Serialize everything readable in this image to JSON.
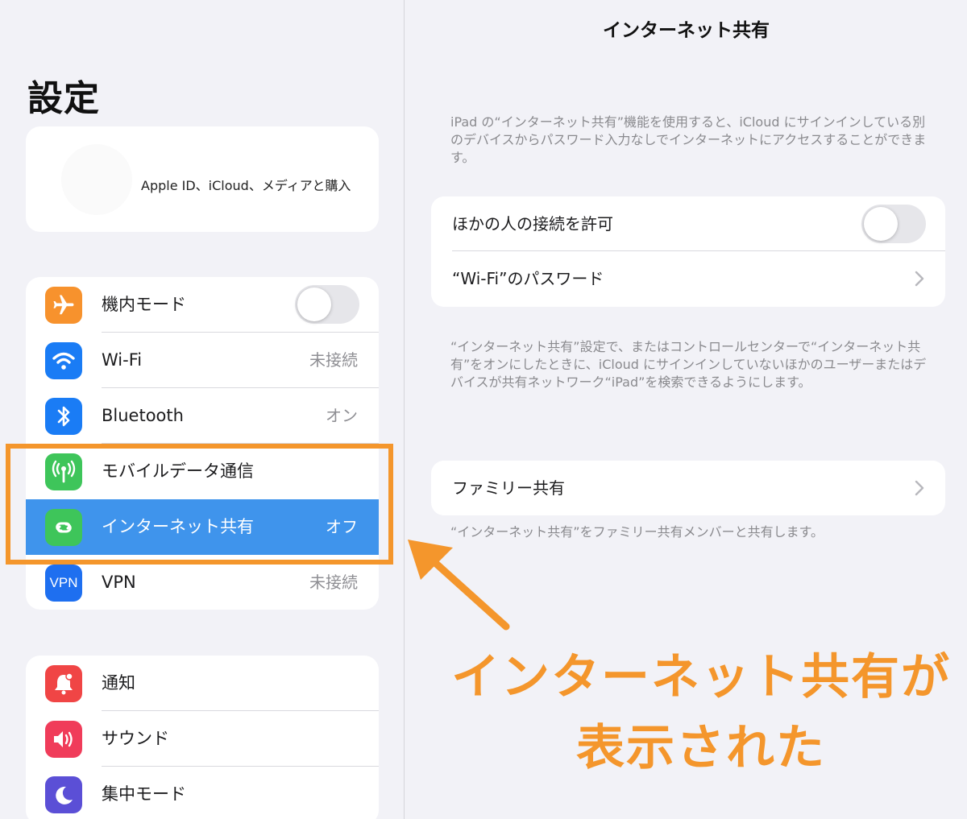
{
  "sidebar": {
    "title": "設定",
    "profile_subtitle": "Apple ID、iCloud、メディアと購入",
    "group1": [
      {
        "name": "airplane",
        "label": "機内モード",
        "value": "",
        "icon": "airplane-icon",
        "color": "#f7922d",
        "toggle": "off"
      },
      {
        "name": "wifi",
        "label": "Wi-Fi",
        "value": "未接続",
        "icon": "wifi-icon",
        "color": "#1a7cf5"
      },
      {
        "name": "bluetooth",
        "label": "Bluetooth",
        "value": "オン",
        "icon": "bluetooth-icon",
        "color": "#1a7cf5"
      },
      {
        "name": "cellular",
        "label": "モバイルデータ通信",
        "value": "",
        "icon": "antenna-icon",
        "color": "#3ec55a"
      },
      {
        "name": "hotspot",
        "label": "インターネット共有",
        "value": "オフ",
        "icon": "hotspot-link-icon",
        "color": "#3ec55a",
        "selected": true
      },
      {
        "name": "vpn",
        "label": "VPN",
        "value": "未接続",
        "icon": "vpn-icon",
        "icon_text": "VPN",
        "color": "#1e6ff0"
      }
    ],
    "group2": [
      {
        "name": "notifications",
        "label": "通知",
        "icon": "bell-icon",
        "color": "#f04545"
      },
      {
        "name": "sounds",
        "label": "サウンド",
        "icon": "speaker-icon",
        "color": "#f03c5a"
      },
      {
        "name": "focus",
        "label": "集中モード",
        "icon": "moon-icon",
        "color": "#5b4fd6"
      }
    ]
  },
  "detail": {
    "nav_title": "インターネット共有",
    "intro": "iPad の“インターネット共有”機能を使用すると、iCloud にサインインしている別のデバイスからパスワード入力なしでインターネットにアクセスすることができます。",
    "allow_others_label": "ほかの人の接続を許可",
    "allow_others_state": "off",
    "wifi_password_label": "“Wi-Fi”のパスワード",
    "middle_note": "“インターネット共有”設定で、またはコントロールセンターで“インターネット共有”をオンにしたときに、iCloud にサインインしていないほかのユーザーまたはデバイスが共有ネットワーク“iPad”を検索できるようにします。",
    "family_label": "ファミリー共有",
    "family_note": "“インターネット共有”をファミリー共有メンバーと共有します。"
  },
  "annotation": {
    "line1": "インターネット共有が",
    "line2": "表示された",
    "color": "#f4962c"
  }
}
